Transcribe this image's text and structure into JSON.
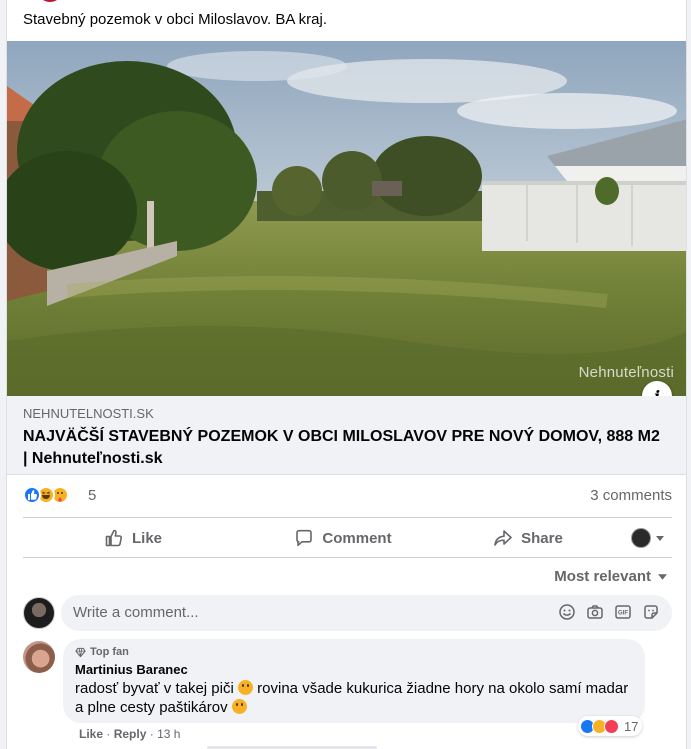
{
  "post": {
    "text": "Stavebný pozemok v obci Miloslavov. BA kraj.",
    "image_watermark": "Nehnuteľnosti"
  },
  "link_preview": {
    "domain": "NEHNUTELNOSTI.SK",
    "title": "NAJVÄČŠÍ STAVEBNÝ POZEMOK V OBCI MILOSLAVOV PRE NOVÝ DOMOV, 888 M2 | Nehnuteľnosti.sk"
  },
  "reactions": {
    "icons": [
      "like-icon",
      "haha-icon",
      "care-icon"
    ],
    "count": "5",
    "comments_label": "3 comments"
  },
  "actions": {
    "like": "Like",
    "comment": "Comment",
    "share": "Share"
  },
  "comments_filter": "Most relevant",
  "composer": {
    "placeholder": "Write a comment...",
    "icons": [
      "emoji-icon",
      "camera-icon",
      "gif-icon",
      "sticker-icon"
    ]
  },
  "comment": {
    "badge": "Top fan",
    "author": "Martinius Baranec",
    "text_part1": "radosť byvať v takej piči",
    "text_part2": "rovina všade kukurica žiadne hory na okolo samí madar a plne cesty paštikárov",
    "reaction_count": "17",
    "like": "Like",
    "reply": "Reply",
    "time": "13 h"
  },
  "colors": {
    "brand_blue": "#1877f2",
    "secondary_text": "#65676b",
    "surface": "#f0f2f5"
  }
}
